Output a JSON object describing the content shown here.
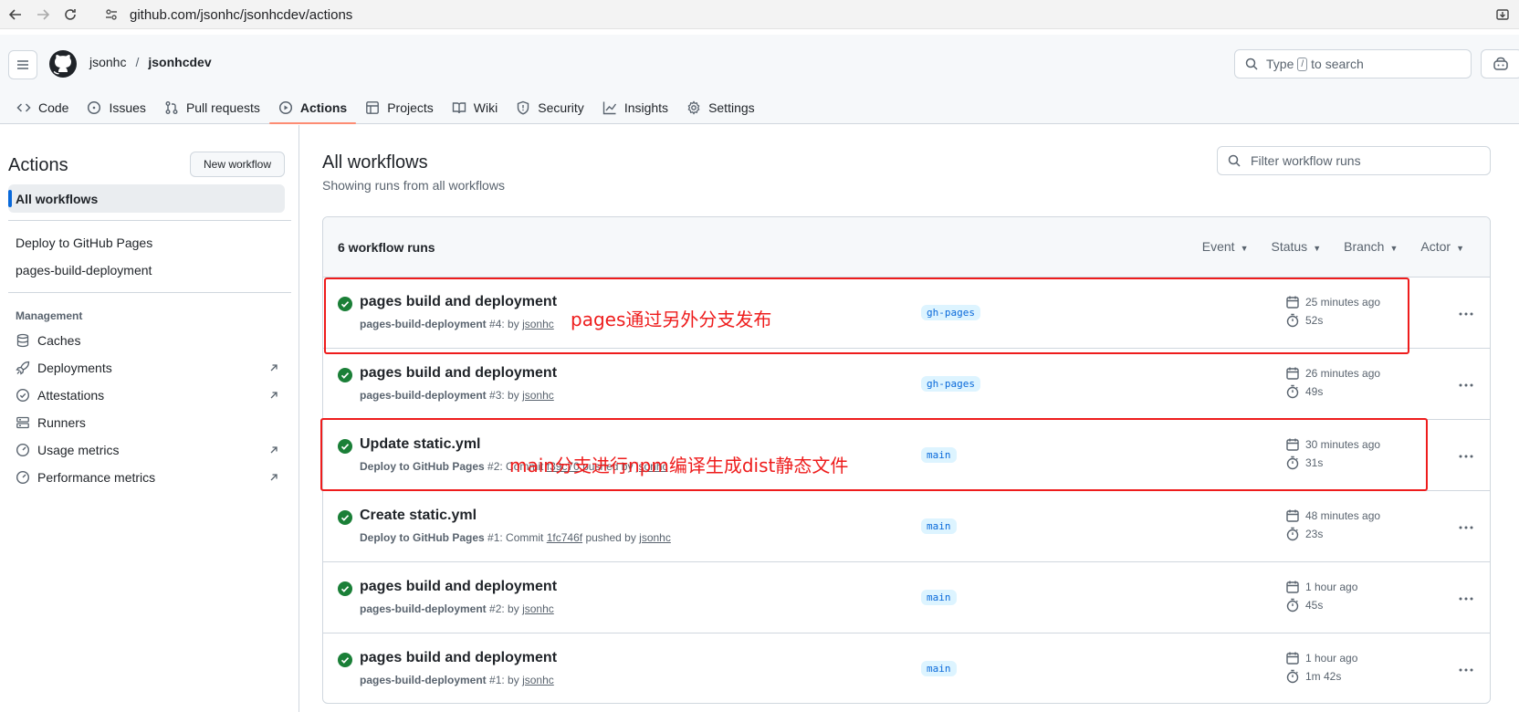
{
  "browser": {
    "url": "github.com/jsonhc/jsonhcdev/actions"
  },
  "header": {
    "owner": "jsonhc",
    "separator": "/",
    "repo": "jsonhcdev",
    "search_prefix": "Type",
    "search_key": "/",
    "search_suffix": "to search"
  },
  "tabs": [
    {
      "label": "Code",
      "icon": "code-icon"
    },
    {
      "label": "Issues",
      "icon": "issue-icon"
    },
    {
      "label": "Pull requests",
      "icon": "pull-request-icon"
    },
    {
      "label": "Actions",
      "icon": "play-icon"
    },
    {
      "label": "Projects",
      "icon": "table-icon"
    },
    {
      "label": "Wiki",
      "icon": "book-icon"
    },
    {
      "label": "Security",
      "icon": "shield-icon"
    },
    {
      "label": "Insights",
      "icon": "graph-icon"
    },
    {
      "label": "Settings",
      "icon": "gear-icon"
    }
  ],
  "sidebar": {
    "title": "Actions",
    "new_workflow": "New workflow",
    "all_workflows": "All workflows",
    "workflows": [
      "Deploy to GitHub Pages",
      "pages-build-deployment"
    ],
    "management_heading": "Management",
    "management": [
      {
        "label": "Caches",
        "icon": "database-icon",
        "external": false
      },
      {
        "label": "Deployments",
        "icon": "rocket-icon",
        "external": true
      },
      {
        "label": "Attestations",
        "icon": "verified-icon",
        "external": true
      },
      {
        "label": "Runners",
        "icon": "server-icon",
        "external": false
      },
      {
        "label": "Usage metrics",
        "icon": "meter-icon",
        "external": true
      },
      {
        "label": "Performance metrics",
        "icon": "meter-icon",
        "external": true
      }
    ]
  },
  "main": {
    "title": "All workflows",
    "subtitle": "Showing runs from all workflows",
    "filter_placeholder": "Filter workflow runs",
    "runs_count": "6 workflow runs",
    "filters": [
      "Event",
      "Status",
      "Branch",
      "Actor"
    ]
  },
  "runs": [
    {
      "title": "pages build and deployment",
      "workflow": "pages-build-deployment",
      "number": "#4",
      "detail": ": by ",
      "commit": "",
      "detail2": "",
      "actor": "jsonhc",
      "branch": "gh-pages",
      "time": "25 minutes ago",
      "duration": "52s"
    },
    {
      "title": "pages build and deployment",
      "workflow": "pages-build-deployment",
      "number": "#3",
      "detail": ": by ",
      "commit": "",
      "detail2": "",
      "actor": "jsonhc",
      "branch": "gh-pages",
      "time": "26 minutes ago",
      "duration": "49s"
    },
    {
      "title": "Update static.yml",
      "workflow": "Deploy to GitHub Pages",
      "number": "#2",
      "detail": ": Commit ",
      "commit": "f39c70",
      "detail2": " pushed by ",
      "actor": "jsonhc",
      "branch": "main",
      "time": "30 minutes ago",
      "duration": "31s"
    },
    {
      "title": "Create static.yml",
      "workflow": "Deploy to GitHub Pages",
      "number": "#1",
      "detail": ": Commit ",
      "commit": "1fc746f",
      "detail2": " pushed by ",
      "actor": "jsonhc",
      "branch": "main",
      "time": "48 minutes ago",
      "duration": "23s"
    },
    {
      "title": "pages build and deployment",
      "workflow": "pages-build-deployment",
      "number": "#2",
      "detail": ": by ",
      "commit": "",
      "detail2": "",
      "actor": "jsonhc",
      "branch": "main",
      "time": "1 hour ago",
      "duration": "45s"
    },
    {
      "title": "pages build and deployment",
      "workflow": "pages-build-deployment",
      "number": "#1",
      "detail": ": by ",
      "commit": "",
      "detail2": "",
      "actor": "jsonhc",
      "branch": "main",
      "time": "1 hour ago",
      "duration": "1m 42s"
    }
  ],
  "annotations": {
    "first": "pages通过另外分支发布",
    "second": "main分支进行npm编译生成dist静态文件",
    "color": "#ee1c1c"
  },
  "colors": {
    "success": "#1a7f37",
    "accent": "#0969da",
    "tab_underline": "#fd8c73"
  }
}
